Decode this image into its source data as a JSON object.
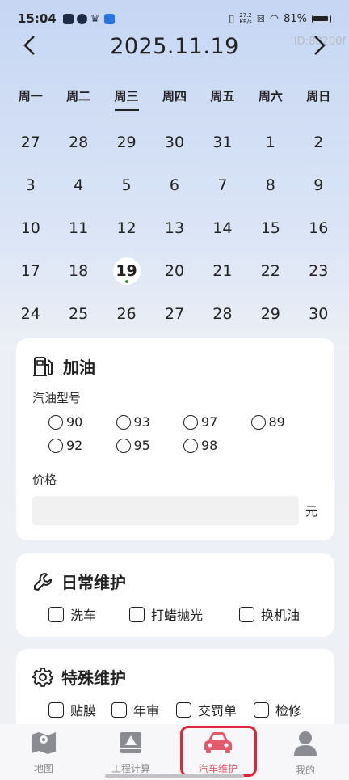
{
  "status": {
    "time": "15:04",
    "net_speed_top": "27.2",
    "net_speed_unit": "KB/s",
    "battery": "81%"
  },
  "header": {
    "date": "2025.11.19",
    "watermark": "ID:88200f"
  },
  "weekdays": [
    "周一",
    "周二",
    "周三",
    "周四",
    "周五",
    "周六",
    "周日"
  ],
  "calendar": {
    "weeks": [
      [
        "27",
        "28",
        "29",
        "30",
        "31",
        "1",
        "2"
      ],
      [
        "3",
        "4",
        "5",
        "6",
        "7",
        "8",
        "9"
      ],
      [
        "10",
        "11",
        "12",
        "13",
        "14",
        "15",
        "16"
      ],
      [
        "17",
        "18",
        "19",
        "20",
        "21",
        "22",
        "23"
      ],
      [
        "24",
        "25",
        "26",
        "27",
        "28",
        "29",
        "30"
      ]
    ],
    "selected": "19"
  },
  "refuel": {
    "title": "加油",
    "fuel_type_label": "汽油型号",
    "options": [
      "90",
      "93",
      "97",
      "89",
      "92",
      "95",
      "98"
    ],
    "price_label": "价格",
    "price_value": "",
    "unit": "元"
  },
  "daily": {
    "title": "日常维护",
    "items": [
      "洗车",
      "打蜡抛光",
      "换机油"
    ]
  },
  "special": {
    "title": "特殊维护",
    "items": [
      "贴膜",
      "年审",
      "交罚单",
      "检修"
    ]
  },
  "tabs": [
    "地图",
    "工程计算",
    "汽车维护",
    "我的"
  ],
  "colors": {
    "accent": "#e35b6b",
    "highlight_frame": "#e0253a"
  }
}
